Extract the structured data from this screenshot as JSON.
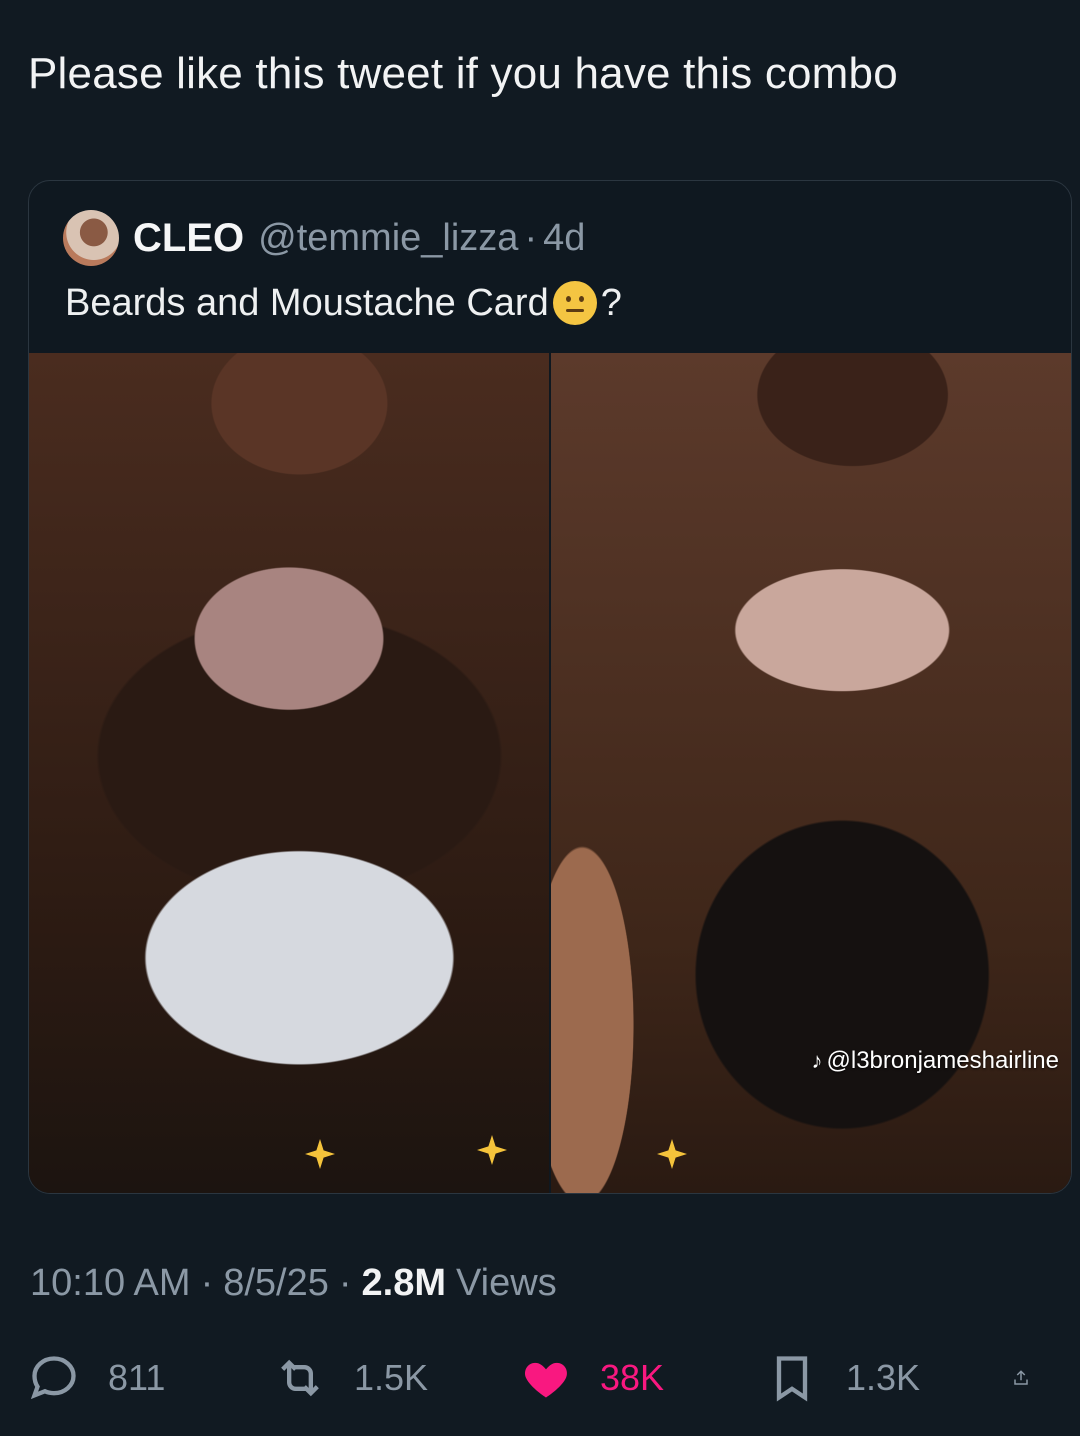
{
  "tweet": {
    "text": "Please like this tweet if you have this combo"
  },
  "quoted": {
    "author": "CLEO",
    "handle": "@temmie_lizza",
    "separator": "·",
    "age": "4d",
    "text_before_emoji": "Beards and Moustache Card",
    "emoji_name": "face-with-diagonal-mouth",
    "text_after_emoji": "?",
    "media": {
      "left_photo": "photo",
      "right_photo": "photo",
      "watermark": "@l3bronjameshairline"
    }
  },
  "meta": {
    "time": "10:10 AM",
    "sep": "·",
    "date": "8/5/25",
    "views_count": "2.8M",
    "views_label": "Views"
  },
  "actions": {
    "reply_count": "811",
    "retweet_count": "1.5K",
    "like_count": "38K",
    "bookmark_count": "1.3K",
    "share_icon": "share-icon"
  },
  "colors": {
    "background": "#111a22",
    "like": "#f91880",
    "muted": "#8b98a5"
  }
}
